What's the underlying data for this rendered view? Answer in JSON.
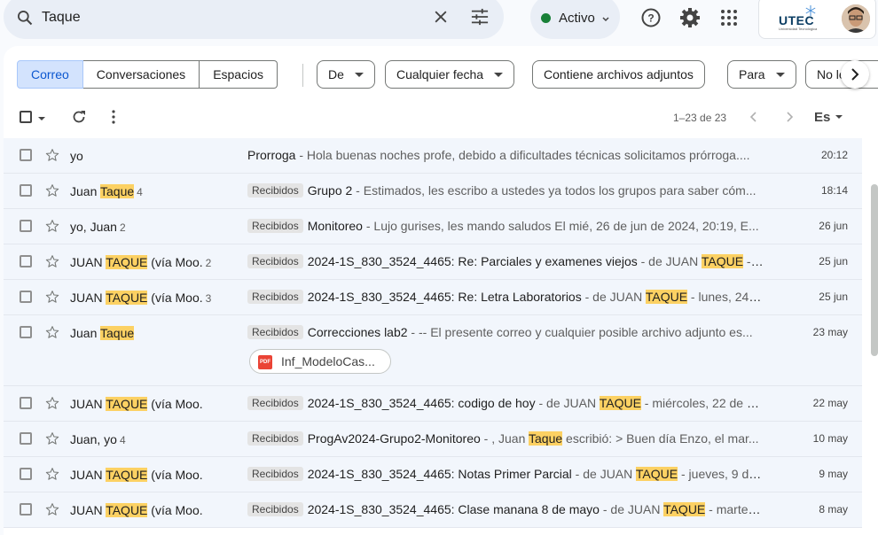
{
  "search": {
    "query": "Taque"
  },
  "status": {
    "label": "Activo",
    "color": "#188038"
  },
  "account": {
    "logo": "UTEC",
    "subtitle": "Universidad Tecnológica"
  },
  "segments": [
    "Correo",
    "Conversaciones",
    "Espacios"
  ],
  "filters": {
    "from": "De",
    "date": "Cualquier fecha",
    "attachments": "Contiene archivos adjuntos",
    "to": "Para",
    "unread": "No leídos"
  },
  "toolbar": {
    "range": "1–23 de 23",
    "language": "Es"
  },
  "emails": [
    {
      "sender": "yo",
      "count": "",
      "label": "",
      "subject": "Prorroga",
      "snippet": " - Hola buenas noches profe, debido a dificultades técnicas solicitamos prórroga....",
      "date": "20:12"
    },
    {
      "sender_pre": "Juan ",
      "sender_hl": "Taque",
      "sender_post": "",
      "count": "4",
      "label": "Recibidos",
      "subject": "Grupo 2",
      "snippet": " - Estimados, les escribo a ustedes ya todos los grupos para saber cóm...",
      "date": "18:14"
    },
    {
      "sender": "yo, Juan",
      "count": "2",
      "label": "Recibidos",
      "subject": "Monitoreo",
      "snippet": " - Lujo gurises, les mando saludos El mié, 26 de jun de 2024, 20:19, E...",
      "date": "26 jun"
    },
    {
      "sender_pre": "JUAN ",
      "sender_hl": "TAQUE",
      "sender_post": " (vía Moo.",
      "count": "2",
      "label": "Recibidos",
      "subject": "2024-1S_830_3524_4465: Re: Parciales y examenes viejos",
      "snip_pre": " - de JUAN ",
      "snip_hl": "TAQUE",
      "snip_post": " - l...",
      "date": "25 jun"
    },
    {
      "sender_pre": "JUAN ",
      "sender_hl": "TAQUE",
      "sender_post": " (vía Moo.",
      "count": "3",
      "label": "Recibidos",
      "subject": "2024-1S_830_3524_4465: Re: Letra Laboratorios",
      "snip_pre": " - de JUAN ",
      "snip_hl": "TAQUE",
      "snip_post": " - lunes, 24 d...",
      "date": "25 jun"
    },
    {
      "sender_pre": "Juan ",
      "sender_hl": "Taque",
      "sender_post": "",
      "count": "",
      "label": "Recibidos",
      "subject": "Correcciones lab2",
      "snippet": " - -- El presente correo y cualquier posible archivo adjunto es...",
      "date": "23 may",
      "attachment": "Inf_ModeloCas...",
      "attachment_icon": "PDF"
    },
    {
      "sender_pre": "JUAN ",
      "sender_hl": "TAQUE",
      "sender_post": " (vía Moo.",
      "count": "",
      "label": "Recibidos",
      "subject": "2024-1S_830_3524_4465: codigo de hoy",
      "snip_pre": " - de JUAN ",
      "snip_hl": "TAQUE",
      "snip_post": " - miércoles, 22 de m...",
      "date": "22 may"
    },
    {
      "sender": "Juan, yo",
      "count": "4",
      "label": "Recibidos",
      "subject": "ProgAv2024-Grupo2-Monitoreo",
      "snip_pre": " - , Juan ",
      "snip_hl": "Taque",
      "snip_post": " escribió: > Buen día Enzo, el mar...",
      "date": "10 may"
    },
    {
      "sender_pre": "JUAN ",
      "sender_hl": "TAQUE",
      "sender_post": " (vía Moo.",
      "count": "",
      "label": "Recibidos",
      "subject": "2024-1S_830_3524_4465: Notas Primer Parcial",
      "snip_pre": " - de JUAN ",
      "snip_hl": "TAQUE",
      "snip_post": " - jueves, 9 de ...",
      "date": "9 may"
    },
    {
      "sender_pre": "JUAN ",
      "sender_hl": "TAQUE",
      "sender_post": " (vía Moo.",
      "count": "",
      "label": "Recibidos",
      "subject": "2024-1S_830_3524_4465: Clase manana 8 de mayo",
      "snip_pre": " - de JUAN ",
      "snip_hl": "TAQUE",
      "snip_post": " - martes,...",
      "date": "8 may"
    }
  ]
}
